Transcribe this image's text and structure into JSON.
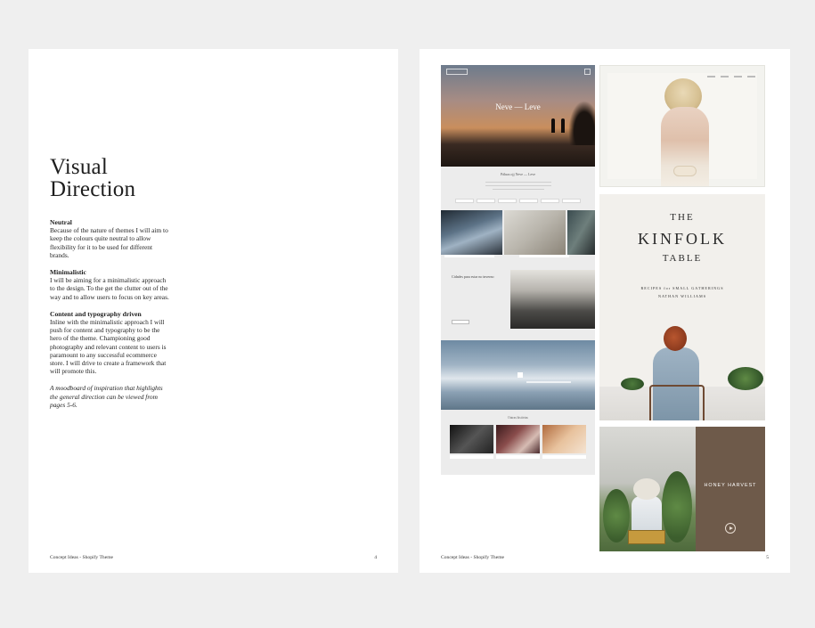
{
  "left_page": {
    "title_line1": "Visual",
    "title_line2": "Direction",
    "sections": [
      {
        "heading": "Neutral",
        "text": "Because of the nature of themes I will aim to keep the colours quite neutral to allow flexibility for it to be used for different brands."
      },
      {
        "heading": "Minimalistic",
        "text": "I will be aiming for a minimalistic approach to the design. To the get the clutter out of the way and to allow users to focus on key areas."
      },
      {
        "heading": "Content and typography driven",
        "text": "Inline with the minimalistic approach I will push for content and typography to be the hero of the theme. Championing good photography and relevant content to users is paramount to any successful ecommerce store. I will drive to create a framework that will promote this."
      }
    ],
    "note": "A moodboard of inspiration that highlights the general direction can be viewed from pages 5-6.",
    "footer_label": "Concept Ideas - Shopify Theme",
    "page_number": "4"
  },
  "right_page": {
    "hero_title": "Neve — Leve",
    "mid_heading": "Páluas ojj Neve — Leve",
    "card_heading": "Cidades para estar no inverno",
    "thumbs_heading": "Outras histórias",
    "kinfolk": {
      "line1": "THE",
      "line2": "KINFOLK",
      "line3": "TABLE",
      "subtitle1": "RECIPES for SMALL GATHERINGS",
      "subtitle2": "NATHAN WILLIAMS"
    },
    "honey": {
      "title": "HONEY HARVEST"
    },
    "footer_label": "Concept Ideas - Shopify Theme",
    "page_number": "5"
  }
}
